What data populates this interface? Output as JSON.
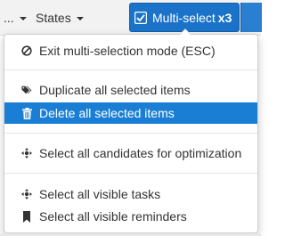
{
  "nav": {
    "prev_label": "...",
    "states_label": "States"
  },
  "multiselect": {
    "label": "Multi-select",
    "count": "x3"
  },
  "menu": {
    "exit": "Exit multi-selection mode (ESC)",
    "duplicate": "Duplicate all selected items",
    "delete": "Delete all selected items",
    "select_candidates": "Select all candidates for optimization",
    "select_tasks": "Select all visible tasks",
    "select_reminders": "Select all visible reminders"
  },
  "colors": {
    "accent": "#1a73c8",
    "active_row": "#1a7fd4"
  }
}
